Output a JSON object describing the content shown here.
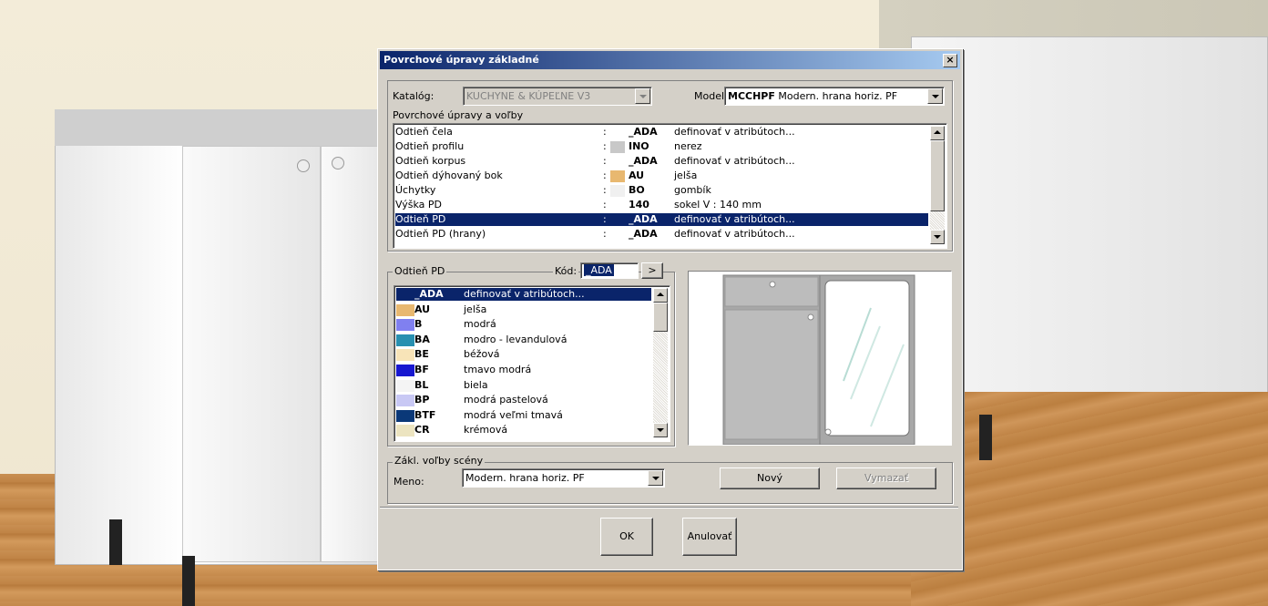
{
  "dialog": {
    "title": "Povrchové úpravy základné",
    "close": "×"
  },
  "catalog": {
    "label": "Katalóg:",
    "value": "KUCHYNE & KÚPEĽNE V3"
  },
  "model": {
    "label": "Model:",
    "code": "MCCHPF",
    "name": "Modern. hrana horiz. PF"
  },
  "surfaces": {
    "label": "Povrchové úpravy a voľby",
    "rows": [
      {
        "name": "Odtieň čela",
        "sep": ":",
        "code": "_ADA",
        "desc": "definovať v atribútoch...",
        "color": ""
      },
      {
        "name": "Odtieň profilu",
        "sep": ":",
        "code": "INO",
        "desc": "nerez",
        "color": "#c8c8c8"
      },
      {
        "name": "Odtieň korpus",
        "sep": ":",
        "code": "_ADA",
        "desc": "definovať v atribútoch...",
        "color": ""
      },
      {
        "name": "Odtieň dýhovaný bok",
        "sep": ":",
        "code": "AU",
        "desc": "jelša",
        "color": "#e8b870"
      },
      {
        "name": "Úchytky",
        "sep": ":",
        "code": "BO",
        "desc": "gombík",
        "color": "#f0f0f0"
      },
      {
        "name": "Výška PD",
        "sep": ":",
        "code": "140",
        "desc": "sokel V : 140 mm",
        "color": ""
      },
      {
        "name": "Odtieň PD",
        "sep": ":",
        "code": "_ADA",
        "desc": "definovať v atribútoch...",
        "color": ""
      },
      {
        "name": "Odtieň PD (hrany)",
        "sep": ":",
        "code": "_ADA",
        "desc": "definovať v atribútoch...",
        "color": ""
      }
    ],
    "selected_index": 6
  },
  "shade_group": {
    "label": "Odtieň PD",
    "code_label": "Kód:",
    "code_value": "_ADA",
    "go_button": ">",
    "items": [
      {
        "code": "_ADA",
        "desc": "definovať v atribútoch...",
        "color": ""
      },
      {
        "code": "AU",
        "desc": "jelša",
        "color": "#e8b870"
      },
      {
        "code": "B",
        "desc": "modrá",
        "color": "#8080f0"
      },
      {
        "code": "BA",
        "desc": "modro - levandulová",
        "color": "#2890b0"
      },
      {
        "code": "BE",
        "desc": "béžová",
        "color": "#f8e4b8"
      },
      {
        "code": "BF",
        "desc": "tmavo modrá",
        "color": "#1818d0"
      },
      {
        "code": "BL",
        "desc": "biela",
        "color": "#f4f4f4"
      },
      {
        "code": "BP",
        "desc": "modrá pastelová",
        "color": "#c8c8f4"
      },
      {
        "code": "BTF",
        "desc": "modrá veľmi tmavá",
        "color": "#0a3878"
      },
      {
        "code": "CR",
        "desc": "krémová",
        "color": "#ece4c0"
      }
    ],
    "selected_index": 0
  },
  "scene": {
    "label": "Zákl. voľby scény",
    "name_label": "Meno:",
    "name_value": "Modern. hrana horiz. PF",
    "new_button": "Nový",
    "delete_button": "Vymazať"
  },
  "footer": {
    "ok": "OK",
    "cancel": "Anulovať"
  }
}
